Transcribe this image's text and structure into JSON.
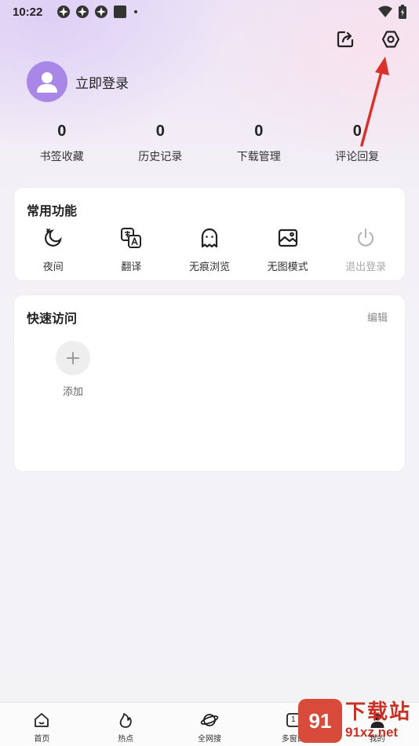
{
  "status_bar": {
    "time": "10:22",
    "icons": [
      "app-notification-icon",
      "app-notification-icon",
      "app-notification-icon",
      "square-notification-icon",
      "dot-icon"
    ],
    "right_icons": [
      "wifi-icon",
      "battery-icon"
    ]
  },
  "header": {
    "actions": [
      "share-icon",
      "settings-icon"
    ]
  },
  "profile": {
    "login_label": "立即登录",
    "avatar_color": "#a987e6"
  },
  "stats": [
    {
      "value": "0",
      "label": "书签收藏"
    },
    {
      "value": "0",
      "label": "历史记录"
    },
    {
      "value": "0",
      "label": "下载管理"
    },
    {
      "value": "0",
      "label": "评论回复"
    }
  ],
  "common_functions": {
    "title": "常用功能",
    "items": [
      {
        "label": "夜间",
        "icon": "night-moon-icon",
        "enabled": true
      },
      {
        "label": "翻译",
        "icon": "translate-icon",
        "enabled": true
      },
      {
        "label": "无痕浏览",
        "icon": "ghost-icon",
        "enabled": true
      },
      {
        "label": "无图模式",
        "icon": "image-off-icon",
        "enabled": true
      },
      {
        "label": "退出登录",
        "icon": "power-icon",
        "enabled": false
      }
    ]
  },
  "quick_access": {
    "title": "快速访问",
    "edit_label": "编辑",
    "add_label": "添加"
  },
  "bottom_nav": [
    {
      "label": "首页",
      "icon": "home-icon"
    },
    {
      "label": "热点",
      "icon": "flame-icon"
    },
    {
      "label": "全网搜",
      "icon": "planet-icon"
    },
    {
      "label": "多窗口",
      "icon": "windows-icon",
      "badge": "1"
    },
    {
      "label": "我的",
      "icon": "user-icon"
    }
  ],
  "watermark": {
    "logo_text": "91",
    "top_text": "下载站",
    "bottom_text": "91xz.net"
  },
  "colors": {
    "accent": "#a987e6",
    "arrow": "#d9322b",
    "watermark": "#c83224"
  }
}
